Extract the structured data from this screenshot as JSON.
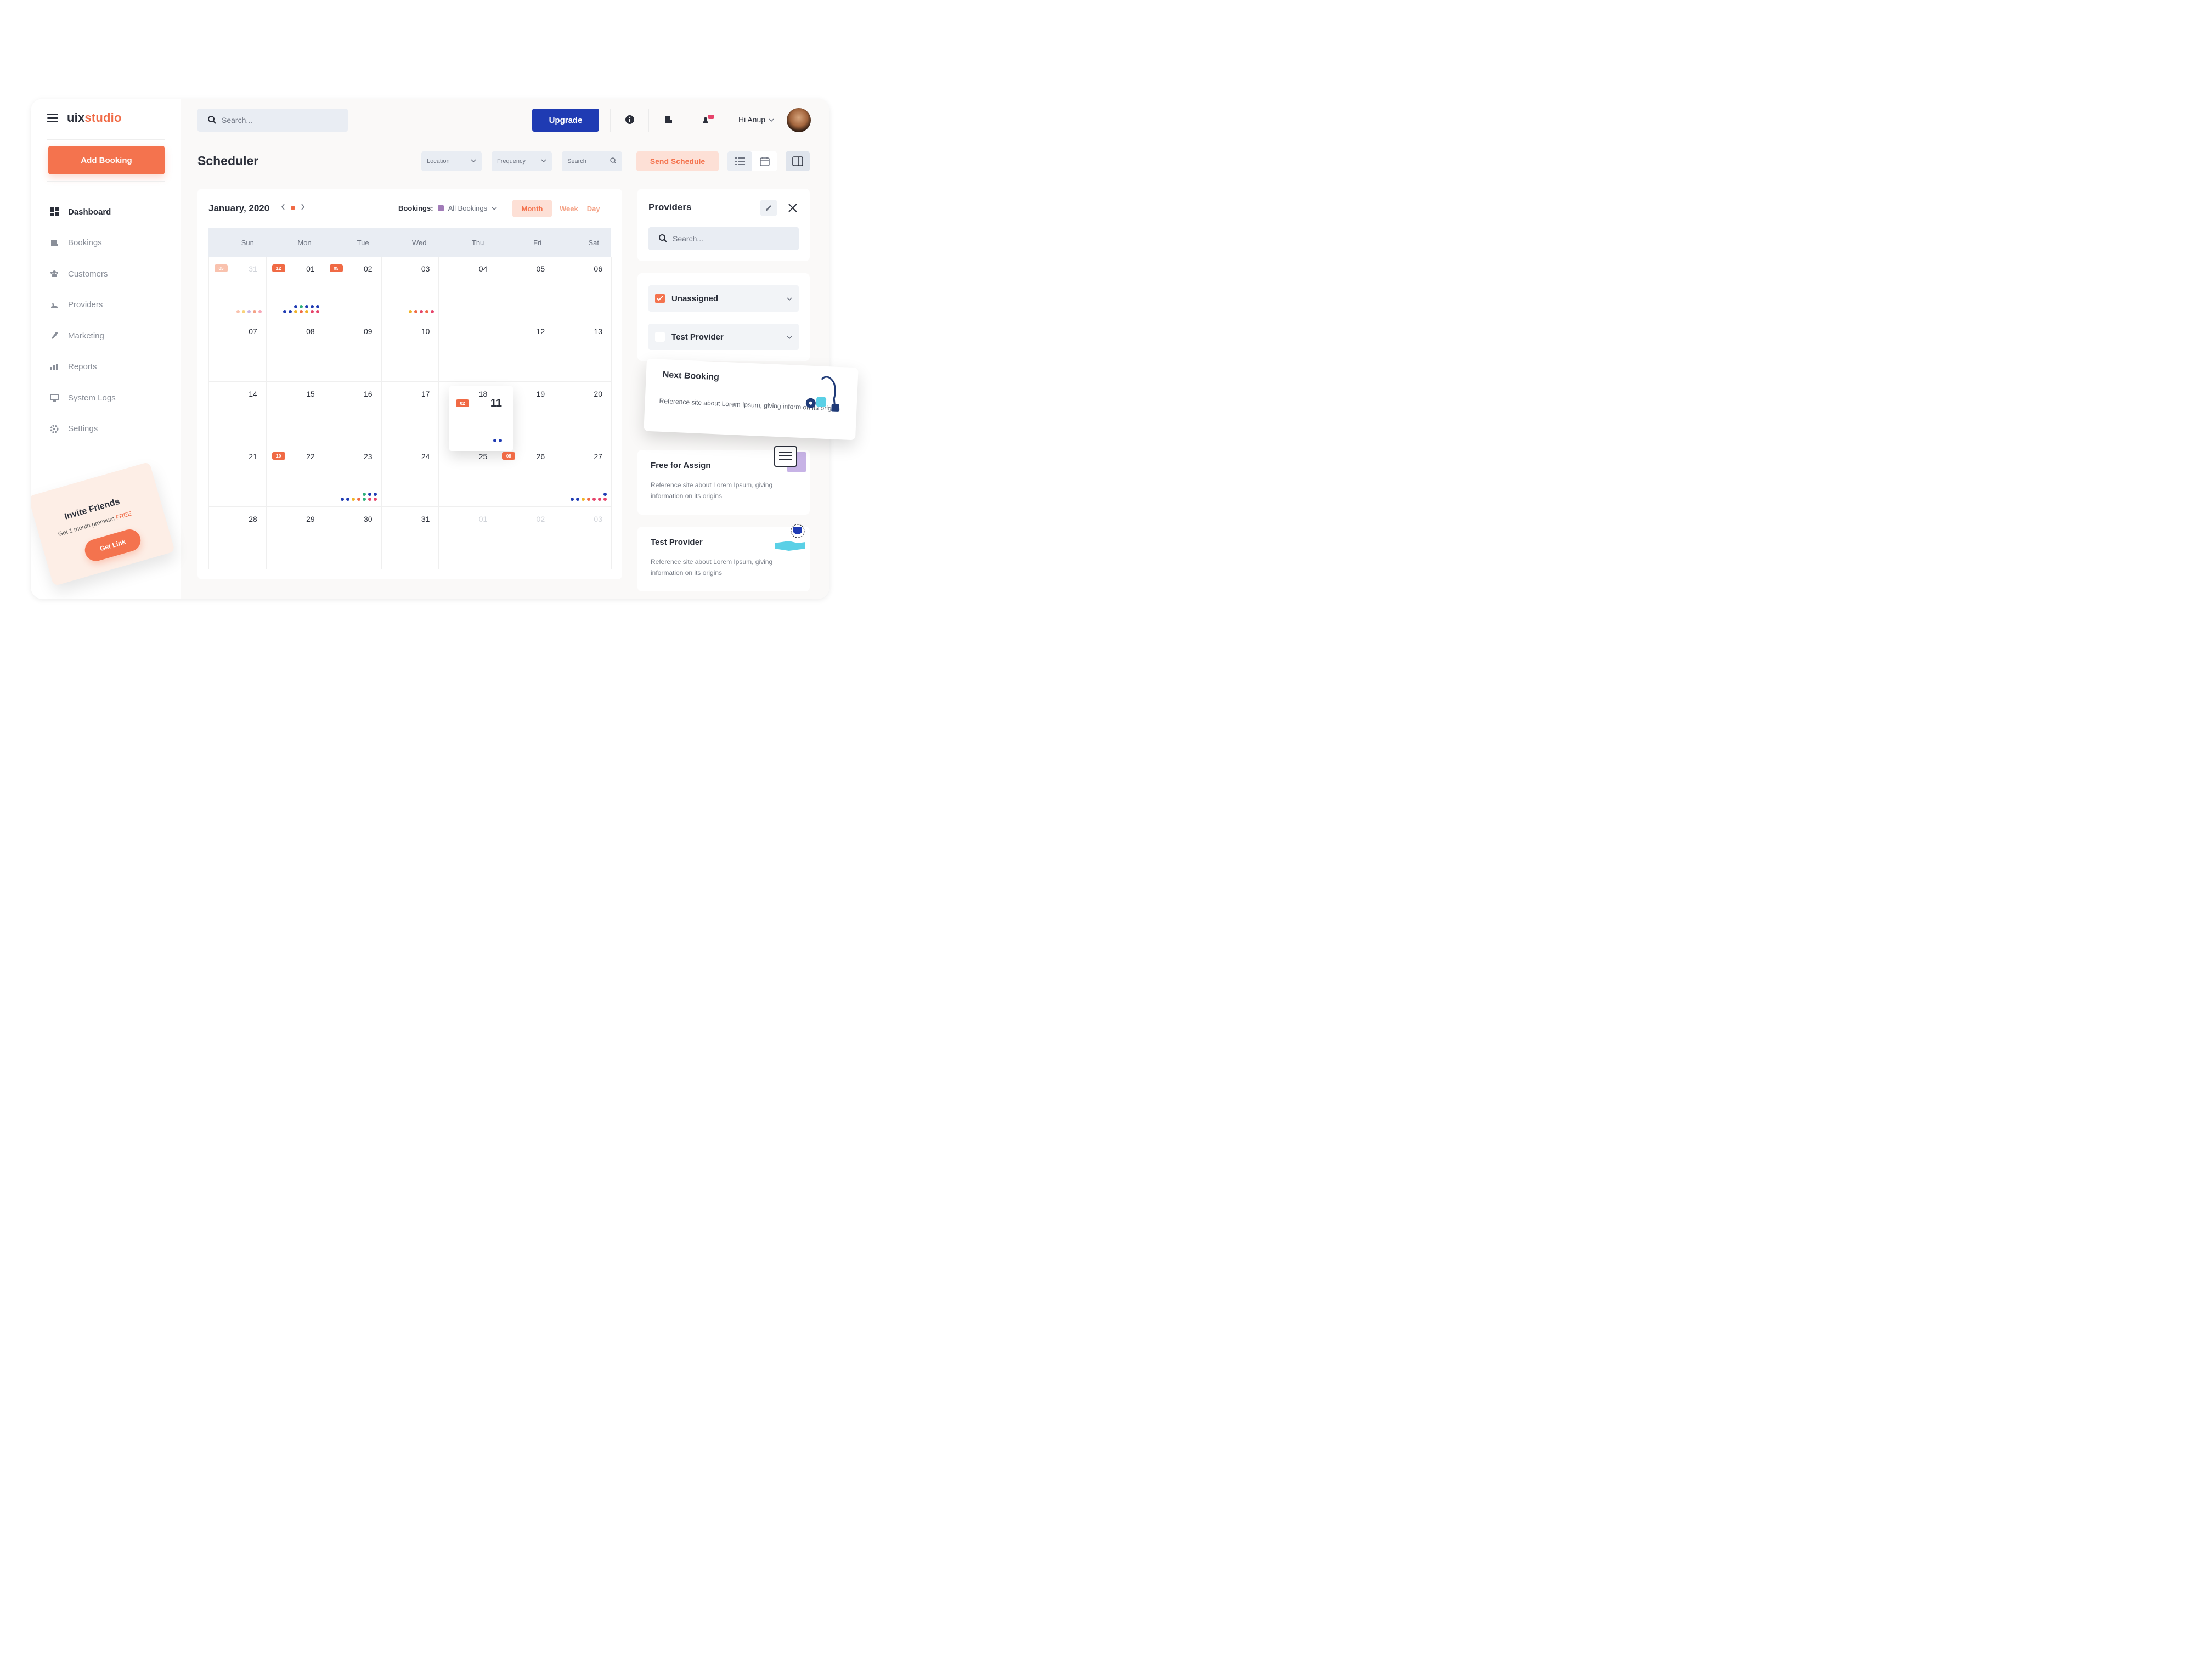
{
  "brand": {
    "part1": "uix",
    "part2": "studio"
  },
  "sidebar": {
    "add_booking": "Add Booking",
    "items": [
      {
        "label": "Dashboard",
        "icon": "dashboard-icon"
      },
      {
        "label": "Bookings",
        "icon": "bookings-icon"
      },
      {
        "label": "Customers",
        "icon": "customers-icon"
      },
      {
        "label": "Providers",
        "icon": "providers-icon"
      },
      {
        "label": "Marketing",
        "icon": "marketing-icon"
      },
      {
        "label": "Reports",
        "icon": "reports-icon"
      },
      {
        "label": "System Logs",
        "icon": "system-logs-icon"
      },
      {
        "label": "Settings",
        "icon": "settings-icon"
      }
    ],
    "invite": {
      "title": "Invite Friends",
      "subtitle": "Get 1 month premium",
      "free": "FREE",
      "button": "Get Link"
    }
  },
  "topbar": {
    "search_placeholder": "Search...",
    "upgrade": "Upgrade",
    "user_greeting": "Hi Anup"
  },
  "scheduler": {
    "title": "Scheduler",
    "filters": {
      "location": "Location",
      "frequency": "Frequency",
      "search": "Search"
    },
    "send_schedule": "Send Schedule"
  },
  "calendar": {
    "month_label": "January, 2020",
    "bookings_label": "Bookings:",
    "bookings_value": "All Bookings",
    "tabs": [
      "Month",
      "Week",
      "Day"
    ],
    "weekdays": [
      "Sun",
      "Mon",
      "Tue",
      "Wed",
      "Thu",
      "Fri",
      "Sat"
    ],
    "weeks": [
      [
        {
          "d": "31",
          "faded": true,
          "badge": "05",
          "badge_faded": true,
          "dots": [
            [
              "#f9c2ae",
              "#f9d27a",
              "#c7b3e6",
              "#f4a286",
              "#f7a8b8"
            ]
          ]
        },
        {
          "d": "01",
          "badge": "12",
          "dots": [
            [
              "#1f3bb3",
              "#2eb07a",
              "#1f3bb3",
              "#1f3bb3",
              "#1f3bb3"
            ],
            [
              "#1f3bb3",
              "#1f3bb3",
              "#f0b429",
              "#f06a45",
              "#f0b429",
              "#e6446b",
              "#e6446b"
            ]
          ]
        },
        {
          "d": "02",
          "badge": "05",
          "dots": []
        },
        {
          "d": "03",
          "dots": [
            [
              "#f0b429",
              "#f06a45",
              "#e6446b",
              "#f06a45",
              "#e6446b"
            ]
          ]
        },
        {
          "d": "04",
          "dots": []
        },
        {
          "d": "05",
          "dots": []
        },
        {
          "d": "06",
          "dots": []
        }
      ],
      [
        {
          "d": "07",
          "dots": []
        },
        {
          "d": "08",
          "dots": []
        },
        {
          "d": "09",
          "dots": []
        },
        {
          "d": "10",
          "dots": []
        },
        {
          "d": "11",
          "popup": true,
          "badge": "02",
          "dots": [
            [
              "#1f3bb3",
              "#1f3bb3"
            ]
          ]
        },
        {
          "d": "12",
          "dots": []
        },
        {
          "d": "13",
          "dots": []
        }
      ],
      [
        {
          "d": "14",
          "dots": []
        },
        {
          "d": "15",
          "dots": []
        },
        {
          "d": "16",
          "dots": []
        },
        {
          "d": "17",
          "dots": []
        },
        {
          "d": "18",
          "dots": []
        },
        {
          "d": "19",
          "dots": []
        },
        {
          "d": "20",
          "dots": []
        }
      ],
      [
        {
          "d": "21",
          "dots": []
        },
        {
          "d": "22",
          "badge": "10",
          "dots": []
        },
        {
          "d": "23",
          "dots": [
            [
              "#2eb07a",
              "#1f3bb3",
              "#1f3bb3"
            ],
            [
              "#1f3bb3",
              "#1f3bb3",
              "#f0b429",
              "#f06a45",
              "#2eb07a",
              "#e6446b",
              "#e6446b"
            ]
          ]
        },
        {
          "d": "24",
          "dots": []
        },
        {
          "d": "25",
          "dots": []
        },
        {
          "d": "26",
          "badge": "08",
          "dots": []
        },
        {
          "d": "27",
          "dots": [
            [
              "#1f3bb3"
            ],
            [
              "#1f3bb3",
              "#1f3bb3",
              "#f0b429",
              "#f06a45",
              "#e6446b",
              "#e6446b",
              "#e6446b"
            ]
          ]
        }
      ],
      [
        {
          "d": "28",
          "dots": []
        },
        {
          "d": "29",
          "dots": []
        },
        {
          "d": "30",
          "dots": []
        },
        {
          "d": "31",
          "dots": []
        },
        {
          "d": "01",
          "faded": true,
          "dots": []
        },
        {
          "d": "02",
          "faded": true,
          "dots": []
        },
        {
          "d": "03",
          "faded": true,
          "dots": []
        }
      ]
    ]
  },
  "providers": {
    "title": "Providers",
    "search_placeholder": "Search...",
    "rows": [
      {
        "label": "Unassigned",
        "checked": true
      },
      {
        "label": "Test Provider",
        "checked": false
      }
    ],
    "cards": [
      {
        "title": "Next Booking",
        "desc": "Reference site about Lorem Ipsum, giving inform on its origins"
      },
      {
        "title": "Free for Assign",
        "desc": "Reference site about Lorem Ipsum, giving information on its origins"
      },
      {
        "title": "Test Provider",
        "desc": "Reference site about Lorem Ipsum, giving information on its origins"
      }
    ]
  },
  "colors": {
    "accent": "#f4734e",
    "primary": "#1f3bb3",
    "text": "#2b2f3a",
    "muted": "#8a8f99"
  }
}
